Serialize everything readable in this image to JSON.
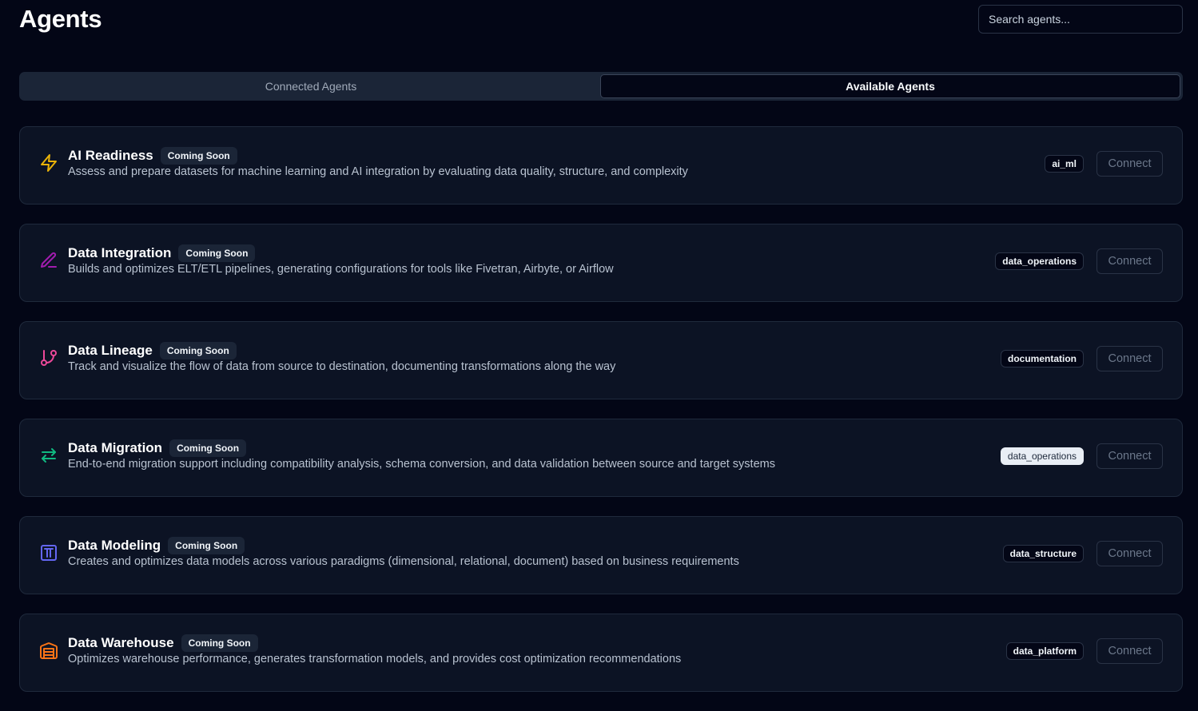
{
  "header": {
    "title": "Agents",
    "search_placeholder": "Search agents..."
  },
  "tabs": [
    {
      "label": "Connected Agents",
      "active": false
    },
    {
      "label": "Available Agents",
      "active": true
    }
  ],
  "agents": [
    {
      "name": "AI Readiness",
      "badge": "Coming Soon",
      "description": "Assess and prepare datasets for machine learning and AI integration by evaluating data quality, structure, and complexity",
      "tag": "ai_ml",
      "connect_label": "Connect",
      "icon": "lightning-icon",
      "icon_color": "#eab308"
    },
    {
      "name": "Data Integration",
      "badge": "Coming Soon",
      "description": "Builds and optimizes ELT/ETL pipelines, generating configurations for tools like Fivetran, Airbyte, or Airflow",
      "tag": "data_operations",
      "connect_label": "Connect",
      "icon": "pen-icon",
      "icon_color": "#a21caf"
    },
    {
      "name": "Data Lineage",
      "badge": "Coming Soon",
      "description": "Track and visualize the flow of data from source to destination, documenting transformations along the way",
      "tag": "documentation",
      "connect_label": "Connect",
      "icon": "git-branch-icon",
      "icon_color": "#ec4899"
    },
    {
      "name": "Data Migration",
      "badge": "Coming Soon",
      "description": "End-to-end migration support including compatibility analysis, schema conversion, and data validation between source and target systems",
      "tag": "data_operations",
      "connect_label": "Connect",
      "icon": "arrows-exchange-icon",
      "icon_color": "#10b981"
    },
    {
      "name": "Data Modeling",
      "badge": "Coming Soon",
      "description": "Creates and optimizes data models across various paradigms (dimensional, relational, document) based on business requirements",
      "tag": "data_structure",
      "connect_label": "Connect",
      "icon": "pi-square-icon",
      "icon_color": "#6366f1"
    },
    {
      "name": "Data Warehouse",
      "badge": "Coming Soon",
      "description": "Optimizes warehouse performance, generates transformation models, and provides cost optimization recommendations",
      "tag": "data_platform",
      "connect_label": "Connect",
      "icon": "warehouse-icon",
      "icon_color": "#f97316"
    }
  ]
}
